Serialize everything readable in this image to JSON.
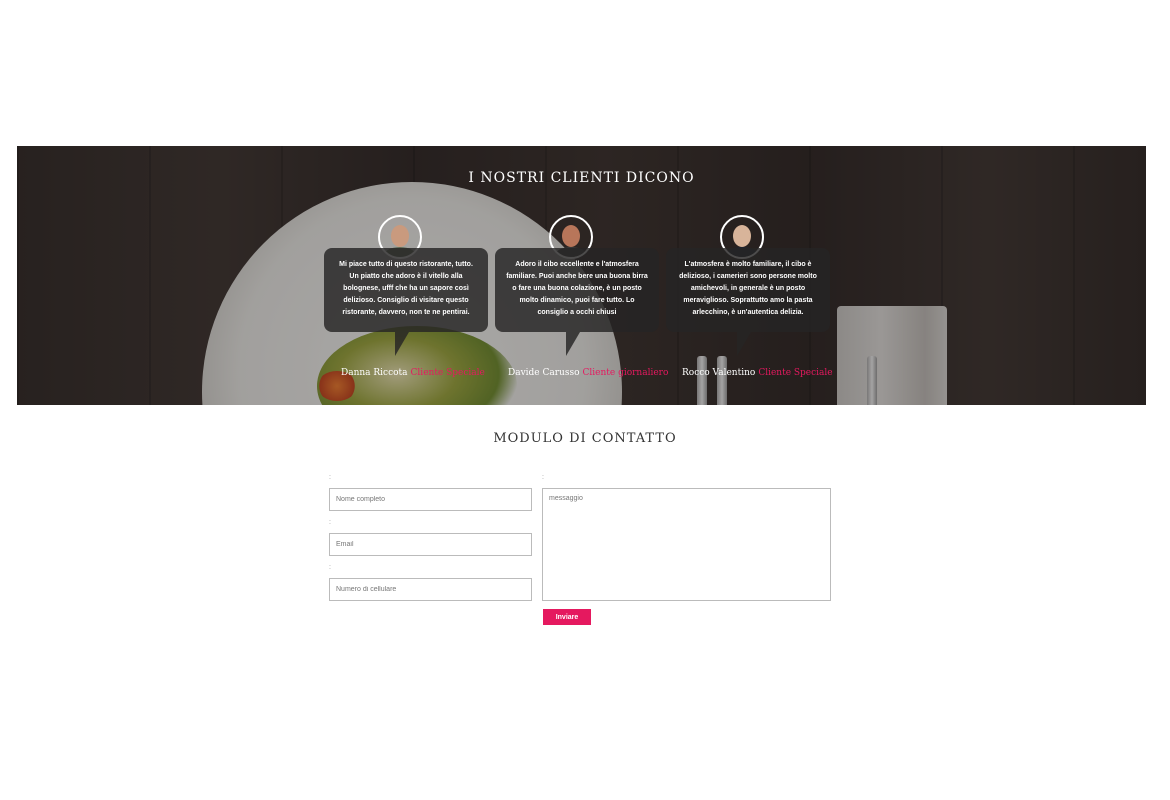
{
  "testimonials": {
    "title": "I NOSTRI CLIENTI DICONO",
    "items": [
      {
        "text": "Mi piace tutto di questo ristorante, tutto. Un piatto che adoro è il vitello alla bolognese, ufff che ha un sapore così delizioso. Consiglio di visitare questo ristorante, davvero, non te ne pentirai.",
        "name": "Danna Riccota",
        "role": "Cliente Speciale"
      },
      {
        "text": "Adoro il cibo eccellente e l'atmosfera familiare. Puoi anche bere una buona birra o fare una buona colazione, è un posto molto dinamico, puoi fare tutto. Lo consiglio a occhi chiusi",
        "name": "Davide Carusso",
        "role": "Cliente giornaliero"
      },
      {
        "text": "L'atmosfera è molto familiare, il cibo è delizioso, i camerieri sono persone molto amichevoli, in generale è un posto meraviglioso. Soprattutto amo la pasta arlecchino, è un'autentica delizia.",
        "name": "Rocco Valentino",
        "role": "Cliente Speciale"
      }
    ]
  },
  "contact": {
    "title": "MODULO DI CONTATTO",
    "label_mark": ":",
    "name_placeholder": "Nome completo",
    "email_placeholder": "Email",
    "phone_placeholder": "Numero di cellulare",
    "message_placeholder": "messaggio",
    "submit_label": "Inviare"
  },
  "colors": {
    "accent": "#e5195f",
    "card_bg": "#262424"
  }
}
